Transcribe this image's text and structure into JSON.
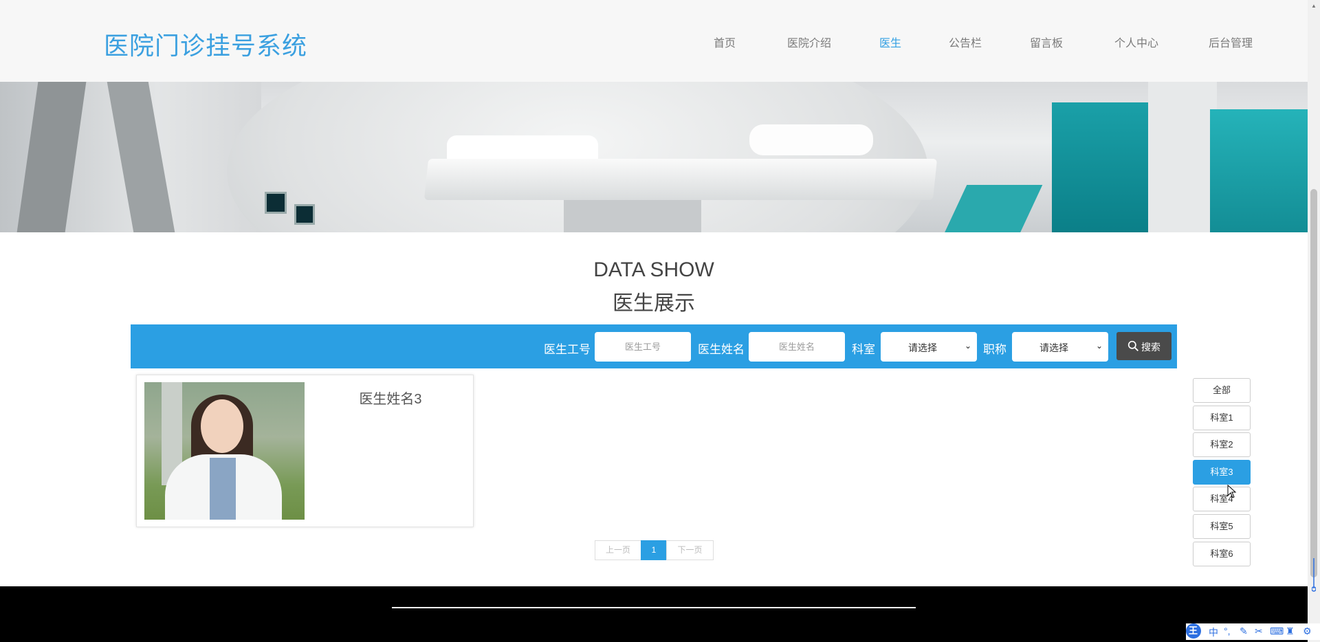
{
  "header": {
    "logo": "医院门诊挂号系统",
    "nav": [
      {
        "label": "首页",
        "active": false
      },
      {
        "label": "医院介绍",
        "active": false
      },
      {
        "label": "医生",
        "active": true
      },
      {
        "label": "公告栏",
        "active": false
      },
      {
        "label": "留言板",
        "active": false
      },
      {
        "label": "个人中心",
        "active": false
      },
      {
        "label": "后台管理",
        "active": false
      }
    ]
  },
  "section": {
    "title_en": "DATA SHOW",
    "title_cn": "医生展示"
  },
  "search": {
    "id_label": "医生工号",
    "id_placeholder": "医生工号",
    "name_label": "医生姓名",
    "name_placeholder": "医生姓名",
    "dept_label": "科室",
    "dept_value": "请选择",
    "title_label": "职称",
    "title_value": "请选择",
    "button_label": "搜索"
  },
  "doctors": [
    {
      "name": "医生姓名3"
    }
  ],
  "pagination": {
    "prev": "上一页",
    "current": "1",
    "next": "下一页"
  },
  "departments": [
    {
      "label": "全部",
      "active": false
    },
    {
      "label": "科室1",
      "active": false
    },
    {
      "label": "科室2",
      "active": false
    },
    {
      "label": "科室3",
      "active": true
    },
    {
      "label": "科室4",
      "active": false
    },
    {
      "label": "科室5",
      "active": false
    },
    {
      "label": "科室6",
      "active": false
    }
  ],
  "ime": {
    "logo": "王",
    "mode": "中"
  },
  "colors": {
    "accent": "#2b9fe3",
    "logo": "#3ba0e0",
    "footer": "#000000",
    "search_button": "#4a4a4a"
  },
  "icons": [
    "search-icon",
    "chevron-down-icon",
    "mouse-cursor-icon"
  ]
}
